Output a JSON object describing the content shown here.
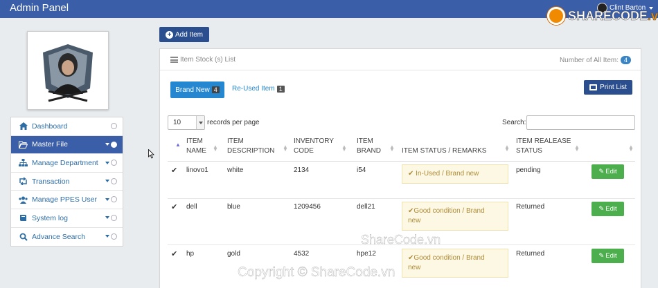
{
  "header": {
    "app_title": "Admin Panel",
    "user_name": "Clint Barton",
    "logo_text_main": "SHARECODE",
    "logo_text_suffix": ".vn"
  },
  "sidebar": {
    "items": [
      {
        "label": "Dashboard",
        "icon": "home-icon",
        "active": false
      },
      {
        "label": "Master File",
        "icon": "folder-open-icon",
        "active": true
      },
      {
        "label": "Manage Department",
        "icon": "sitemap-icon",
        "active": false
      },
      {
        "label": "Transaction",
        "icon": "retweet-icon",
        "active": false
      },
      {
        "label": "Manage PPES User",
        "icon": "users-icon",
        "active": false
      },
      {
        "label": "System log",
        "icon": "book-icon",
        "active": false
      },
      {
        "label": "Advance Search",
        "icon": "search-icon",
        "active": false
      }
    ]
  },
  "toolbar": {
    "add_label": "Add Item"
  },
  "panel": {
    "title": "Item Stock (s) List",
    "count_label": "Number of All Item:",
    "count_value": "4",
    "tabs": [
      {
        "label": "Brand New",
        "badge": "4",
        "active": true
      },
      {
        "label": "Re-Used Item",
        "badge": "1",
        "active": false
      }
    ],
    "print_label": "Print List",
    "length_value": "10",
    "length_label": "records per page",
    "search_label": "Search:",
    "search_value": ""
  },
  "table": {
    "headers": [
      [
        "ITEM",
        "NAME"
      ],
      [
        "ITEM",
        "DESCRIPTION"
      ],
      [
        "INVENTORY",
        "CODE"
      ],
      [
        "ITEM",
        "BRAND"
      ],
      [
        "ITEM STATUS / REMARKS",
        ""
      ],
      [
        "ITEM REALEASE",
        "STATUS"
      ]
    ],
    "rows": [
      {
        "name": "linovo1",
        "description": "white",
        "code": "2134",
        "brand": "i54",
        "status_line1": "✔ In-Used / Brand new",
        "status_line2": "",
        "release": "pending",
        "edit": "Edit"
      },
      {
        "name": "dell",
        "description": "blue",
        "code": "1209456",
        "brand": "dell21",
        "status_line1": "✔Good condition / Brand",
        "status_line2": "new",
        "release": "Returned",
        "edit": "Edit"
      },
      {
        "name": "hp",
        "description": "gold",
        "code": "4532",
        "brand": "hpe12",
        "status_line1": "✔Good condition / Brand",
        "status_line2": "new",
        "release": "Returned",
        "edit": "Edit"
      }
    ]
  },
  "watermarks": {
    "center": "ShareCode.vn",
    "bottom": "Copyright © ShareCode.vn"
  },
  "colors": {
    "topbar": "#3b5ea9",
    "primary_button": "#2b4f8e",
    "tab_active": "#2487cf",
    "edit_button": "#4cae4c",
    "status_bg": "#fcf8e3"
  }
}
